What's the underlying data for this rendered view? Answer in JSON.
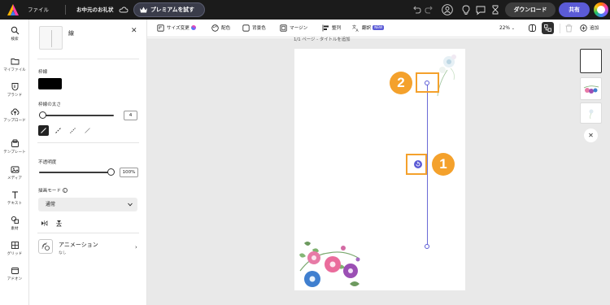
{
  "topbar": {
    "file_label": "ファイル",
    "document_title": "お中元のお礼状",
    "premium_label": "プレミアムを試す",
    "download_label": "ダウンロード",
    "share_label": "共有"
  },
  "rail": {
    "items": [
      {
        "label": "検索",
        "icon": "search-icon"
      },
      {
        "label": "マイファイル",
        "icon": "folder-icon"
      },
      {
        "label": "ブランド",
        "icon": "brand-icon"
      },
      {
        "label": "アップロード",
        "icon": "upload-icon"
      },
      {
        "label": "テンプレート",
        "icon": "template-icon"
      },
      {
        "label": "メディア",
        "icon": "media-icon"
      },
      {
        "label": "テキスト",
        "icon": "text-icon"
      },
      {
        "label": "素材",
        "icon": "elements-icon"
      },
      {
        "label": "グリッド",
        "icon": "grid-icon"
      },
      {
        "label": "アドオン",
        "icon": "addon-icon"
      }
    ]
  },
  "panel": {
    "title": "線",
    "stroke_label": "枠線",
    "stroke_color": "#000000",
    "weight_label": "枠線の太さ",
    "weight_value": "4",
    "weight_fraction": 0.05,
    "opacity_label": "不透明度",
    "opacity_value": "100%",
    "opacity_fraction": 1.0,
    "blend_label": "描画モード",
    "blend_value": "通常",
    "animation_title": "アニメーション",
    "animation_sub": "なし"
  },
  "toolbar": {
    "resize_label": "サイズ変更",
    "layout_label": "配色",
    "background_label": "背景色",
    "margin_label": "マージン",
    "align_label": "整列",
    "translate_label": "翻訳",
    "translate_badge": "NEW",
    "zoom_value": "22%",
    "add_label": "追加"
  },
  "canvas": {
    "page_label": "1/1 ページ - タイトルを追加",
    "annotations": [
      "1",
      "2"
    ]
  },
  "colors": {
    "accent": "#5b5bd6",
    "highlight": "#f4a12c",
    "topbar": "#1b1b1b"
  }
}
